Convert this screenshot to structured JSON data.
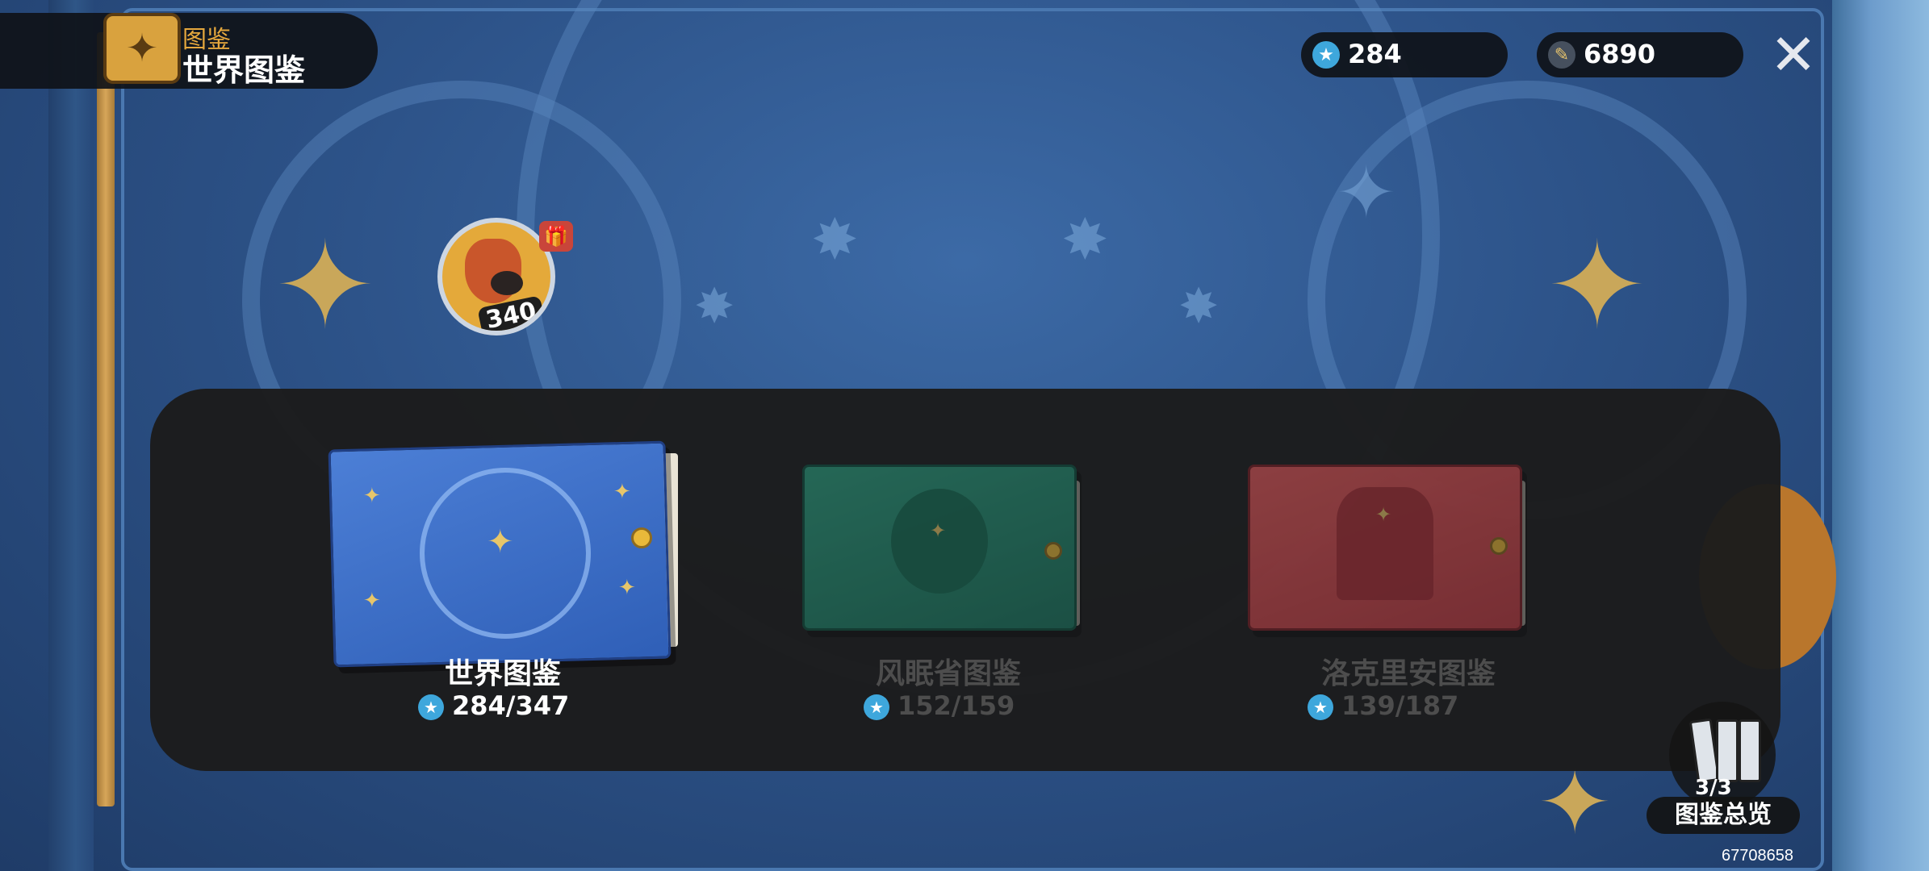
{
  "header": {
    "category": "图鉴",
    "title": "世界图鉴",
    "icon": "codex-book-icon"
  },
  "currencies": [
    {
      "name": "star-coin",
      "icon": "star-coin-icon",
      "value": "284",
      "color": "#3ea7dc"
    },
    {
      "name": "ticket",
      "icon": "scroll-ticket-icon",
      "value": "6890",
      "color": "#d9a23e"
    }
  ],
  "close": {
    "icon": "close-icon"
  },
  "creature_badge": {
    "count": "340",
    "gift_icon": "gift-icon"
  },
  "books": [
    {
      "name": "世界图鉴",
      "progress": "284/347",
      "state": "selected",
      "color": "#3a67c0"
    },
    {
      "name": "风眠省图鉴",
      "progress": "152/159",
      "state": "dimmed",
      "color": "#1f8a70"
    },
    {
      "name": "洛克里安图鉴",
      "progress": "139/187",
      "state": "dimmed",
      "color": "#c9454a"
    }
  ],
  "overview": {
    "fraction": "3/3",
    "label": "图鉴总览"
  },
  "uid": "67708658",
  "colors": {
    "accent_gold": "#e6a83d",
    "name_active": "#ffffff",
    "name_dimmed": "#4d4d4d",
    "progress_icon": "#3ea7dc"
  }
}
